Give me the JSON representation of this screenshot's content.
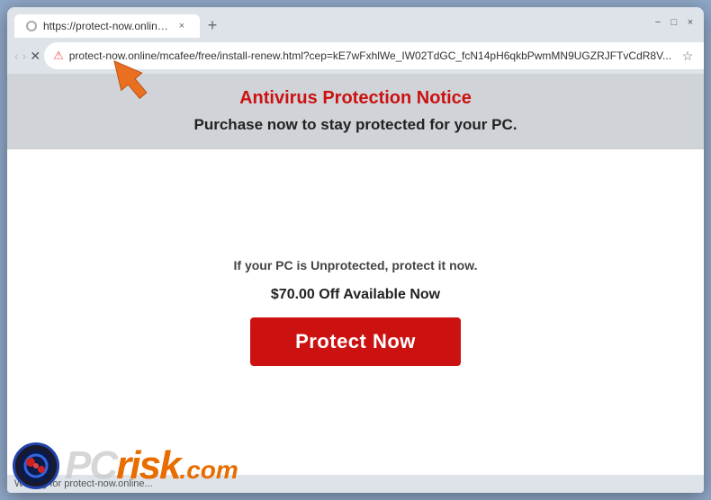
{
  "browser": {
    "tab": {
      "title": "https://protect-now.online/mcaf",
      "close_label": "×"
    },
    "new_tab_label": "+",
    "window_controls": {
      "minimize": "−",
      "maximize": "□",
      "close": "×"
    },
    "nav": {
      "back_label": "‹",
      "forward_label": "›",
      "reload_label": "✕",
      "url": "protect-now.online/mcafee/free/install-renew.html?cep=kE7wFxhlWe_IW02TdGC_fcN14pH6qkbPwmMN9UGZRJFTvCdR8V...",
      "bookmark_label": "☆",
      "profile_label": "⊙",
      "menu_label": "⋮"
    },
    "status_bar": {
      "text": "Waiting for protect-now.online..."
    }
  },
  "page": {
    "header": {
      "antivirus_title": "Antivirus Protection Notice",
      "subtitle": "Purchase now to stay protected for your PC."
    },
    "body": {
      "unprotected_line": "If your PC is ",
      "unprotected_bold": "Unprotected",
      "unprotected_suffix": ", protect ",
      "it_now_bold": "it now",
      "unprotected_end": ".",
      "discount": "$70.00 Off Available Now",
      "button_label": "Protect Now"
    }
  },
  "watermark": {
    "pc_text": "PC",
    "risk_text": "risk",
    "com_text": ".com"
  }
}
